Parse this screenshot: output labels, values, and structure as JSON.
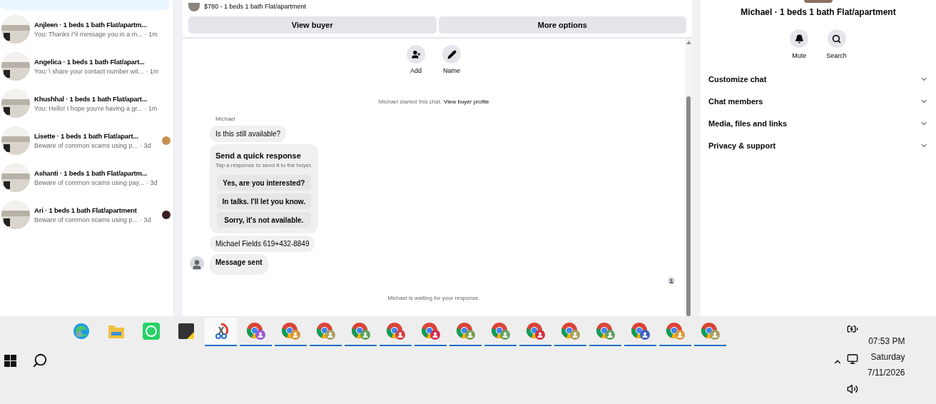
{
  "conversations": [
    {
      "name": "Anjleen · 1 beds 1 bath Flat/apartm...",
      "preview": "You: Thanks i\"il message you in a m...",
      "time": "· 1m",
      "selected": false
    },
    {
      "name": "Angelica · 1 beds 1 bath Flat/apart...",
      "preview": "You: \\ share your contact number wit...",
      "time": "· 1m",
      "selected": false
    },
    {
      "name": "Khushhal · 1 beds 1 bath Flat/apart...",
      "preview": "You: Hello! I hope you're having a gr...",
      "time": "· 1m",
      "selected": false
    },
    {
      "name": "Lisette · 1 beds 1 bath Flat/apart...",
      "preview": "Beware of common scams using p...",
      "time": "· 3d",
      "selected": false,
      "color": "#c89050"
    },
    {
      "name": "Ashanti · 1 beds 1 bath Flat/apartm...",
      "preview": "Beware of common scams using pay...",
      "time": "· 3d",
      "selected": false
    },
    {
      "name": "Ari · 1 beds 1 bath Flat/apartment",
      "preview": "Beware of common scams using p...",
      "time": "· 3d",
      "selected": false,
      "color": "#3a2020"
    }
  ],
  "listing": {
    "title": "$780 - 1 beds 1 bath Flat/apartment",
    "buttons": [
      "View buyer",
      "More options"
    ]
  },
  "chat_actions": [
    {
      "kind": "add",
      "label": "Add"
    },
    {
      "kind": "name",
      "label": "Name"
    }
  ],
  "chat": {
    "started": "Michael started this chat.",
    "profile_link": "View buyer profile",
    "sender": "Michael",
    "first_message": "Is this still available?",
    "quick_response": {
      "title": "Send a quick response",
      "hint": "Tap a response to send it to the buyer.",
      "options": [
        "Yes, are you interested?",
        "In talks. I'll let you know.",
        "Sorry, it's not available."
      ]
    },
    "contact_message": "Michael Fields 619+432-8849",
    "last_message": "Message sent",
    "waiting": "Michael is waiting for your response."
  },
  "details": {
    "title": "Michael · 1 beds 1 bath Flat/apartment",
    "actions": [
      {
        "kind": "mute",
        "label": "Mute"
      },
      {
        "kind": "search",
        "label": "Search"
      }
    ],
    "sections": [
      {
        "label": "Customize chat",
        "expanded": false
      },
      {
        "label": "Chat members",
        "expanded": false
      },
      {
        "label": "Media, files and links",
        "expanded": false
      },
      {
        "label": "Privacy & support",
        "expanded": false
      }
    ]
  },
  "taskbar": {
    "apps": [
      {
        "kind": "edge",
        "running": false,
        "selected": false
      },
      {
        "kind": "explorer",
        "running": false,
        "selected": false
      },
      {
        "kind": "whatsapp",
        "running": false,
        "selected": false
      },
      {
        "kind": "sticky",
        "running": false,
        "selected": false
      },
      {
        "kind": "snip",
        "running": true,
        "selected": true
      },
      {
        "kind": "chrome",
        "running": true,
        "color": "#9b59d0"
      },
      {
        "kind": "chrome",
        "running": true,
        "color": "#d9963a"
      },
      {
        "kind": "chrome",
        "running": true,
        "color": "#a9a060"
      },
      {
        "kind": "chrome",
        "running": true,
        "color": "#5aa05a"
      },
      {
        "kind": "chrome",
        "running": true,
        "color": "#d04040"
      },
      {
        "kind": "chrome",
        "running": true,
        "color": "#d03050"
      },
      {
        "kind": "chrome",
        "running": true,
        "color": "#7aa050"
      },
      {
        "kind": "chrome",
        "running": true,
        "color": "#6aa060"
      },
      {
        "kind": "chrome",
        "running": true,
        "color": "#d03040"
      },
      {
        "kind": "chrome",
        "running": true,
        "color": "#a9a060"
      },
      {
        "kind": "chrome",
        "running": true,
        "color": "#60a060"
      },
      {
        "kind": "chrome",
        "running": true,
        "color": "#4060c0"
      },
      {
        "kind": "chrome",
        "running": true,
        "color": "#d9963a"
      },
      {
        "kind": "chrome",
        "running": true,
        "color": "#a9a060"
      }
    ],
    "time": "07:53 PM",
    "day": "Saturday",
    "date": "7/11/2026"
  }
}
